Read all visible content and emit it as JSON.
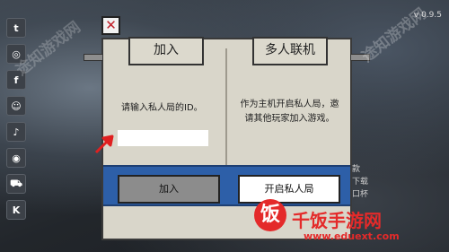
{
  "version": "v 0.9.5",
  "social_icons": [
    {
      "name": "twitter-icon",
      "glyph": "t"
    },
    {
      "name": "instagram-icon",
      "glyph": "◎"
    },
    {
      "name": "facebook-icon",
      "glyph": "f"
    },
    {
      "name": "discord-icon",
      "glyph": "☺"
    },
    {
      "name": "tiktok-icon",
      "glyph": "♪"
    },
    {
      "name": "weibo-icon",
      "glyph": "◉"
    },
    {
      "name": "cart-icon",
      "glyph": "⛟"
    },
    {
      "name": "k-icon",
      "glyph": "K"
    }
  ],
  "close_glyph": "✕",
  "tabs": {
    "join": "加入",
    "multiplayer": "多人联机"
  },
  "join_panel": {
    "prompt": "请输入私人局的ID。",
    "input_value": "",
    "button": "加入"
  },
  "host_panel": {
    "description": "作为主机开启私人局，邀请其他玩家加入游戏。",
    "button": "开启私人局"
  },
  "right_menu": [
    "款",
    "下载",
    "口杯"
  ],
  "watermark": {
    "text": "途知游戏网",
    "brand": "千饭手游网",
    "url": "www.eduext.com",
    "logo_glyph": "饭"
  }
}
